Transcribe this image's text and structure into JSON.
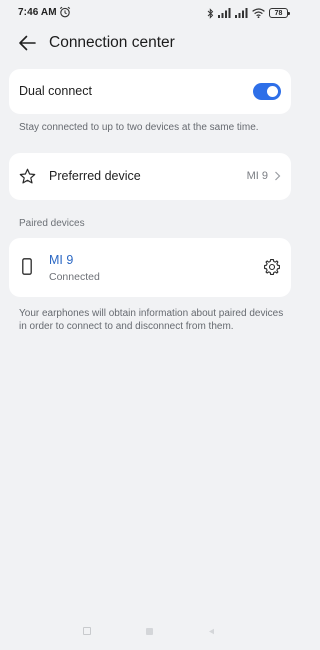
{
  "status_bar": {
    "time": "7:46 AM",
    "battery": "78",
    "icons": [
      "alarm-icon",
      "bluetooth-icon",
      "signal-icon",
      "signal-icon",
      "wifi-icon",
      "battery-icon"
    ]
  },
  "header": {
    "title": "Connection center",
    "back_icon": "arrow-left-icon"
  },
  "dual_connect": {
    "label": "Dual connect",
    "enabled": true,
    "description": "Stay connected to up to two devices at the same time."
  },
  "preferred_device": {
    "label": "Preferred device",
    "value": "MI 9",
    "icon": "star-icon"
  },
  "paired_devices": {
    "section_title": "Paired devices",
    "devices": [
      {
        "name": "MI 9",
        "status": "Connected",
        "icon": "phone-icon"
      }
    ],
    "description": "Your earphones will obtain information about paired devices in order to connect to and disconnect from them."
  },
  "colors": {
    "accent": "#2e6fe8",
    "device_name": "#2b68c4",
    "background": "#f1f2f4",
    "card": "#ffffff"
  },
  "nav_bar": {
    "buttons": [
      "recents-button",
      "home-button",
      "back-button"
    ]
  }
}
